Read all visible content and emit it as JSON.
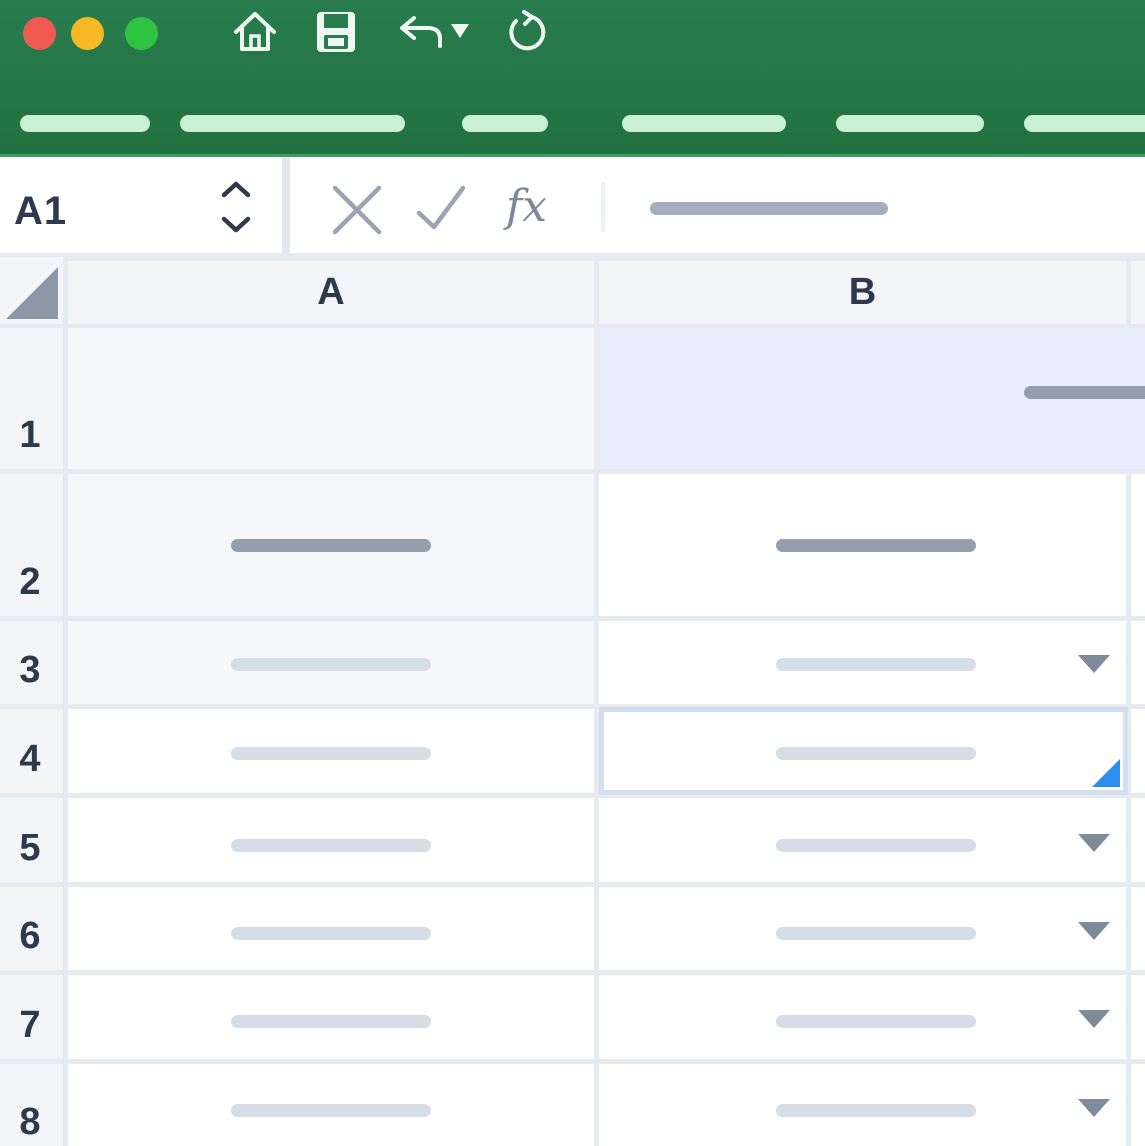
{
  "window": {
    "traffic_lights": [
      "close",
      "minimize",
      "zoom"
    ],
    "toolbar_icons": [
      "home-icon",
      "save-icon",
      "undo-icon",
      "undo-dropdown-icon",
      "redo-icon"
    ],
    "ribbon_tab_count": 6
  },
  "formula_bar": {
    "name_box": "A1",
    "icons": [
      "cancel-icon",
      "confirm-icon",
      "function-icon"
    ],
    "function_label": "fx"
  },
  "grid": {
    "columns": [
      "A",
      "B"
    ],
    "rows": [
      "1",
      "2",
      "3",
      "4",
      "5",
      "6",
      "7",
      "8"
    ],
    "active_cell": "B4"
  },
  "colors": {
    "titlebar": "#287c4e",
    "ribbon_pill": "#c9f0d3",
    "header_text": "#2e3a4c",
    "selection_highlight": "#e8eefb",
    "fill_handle": "#2f8ff0"
  }
}
